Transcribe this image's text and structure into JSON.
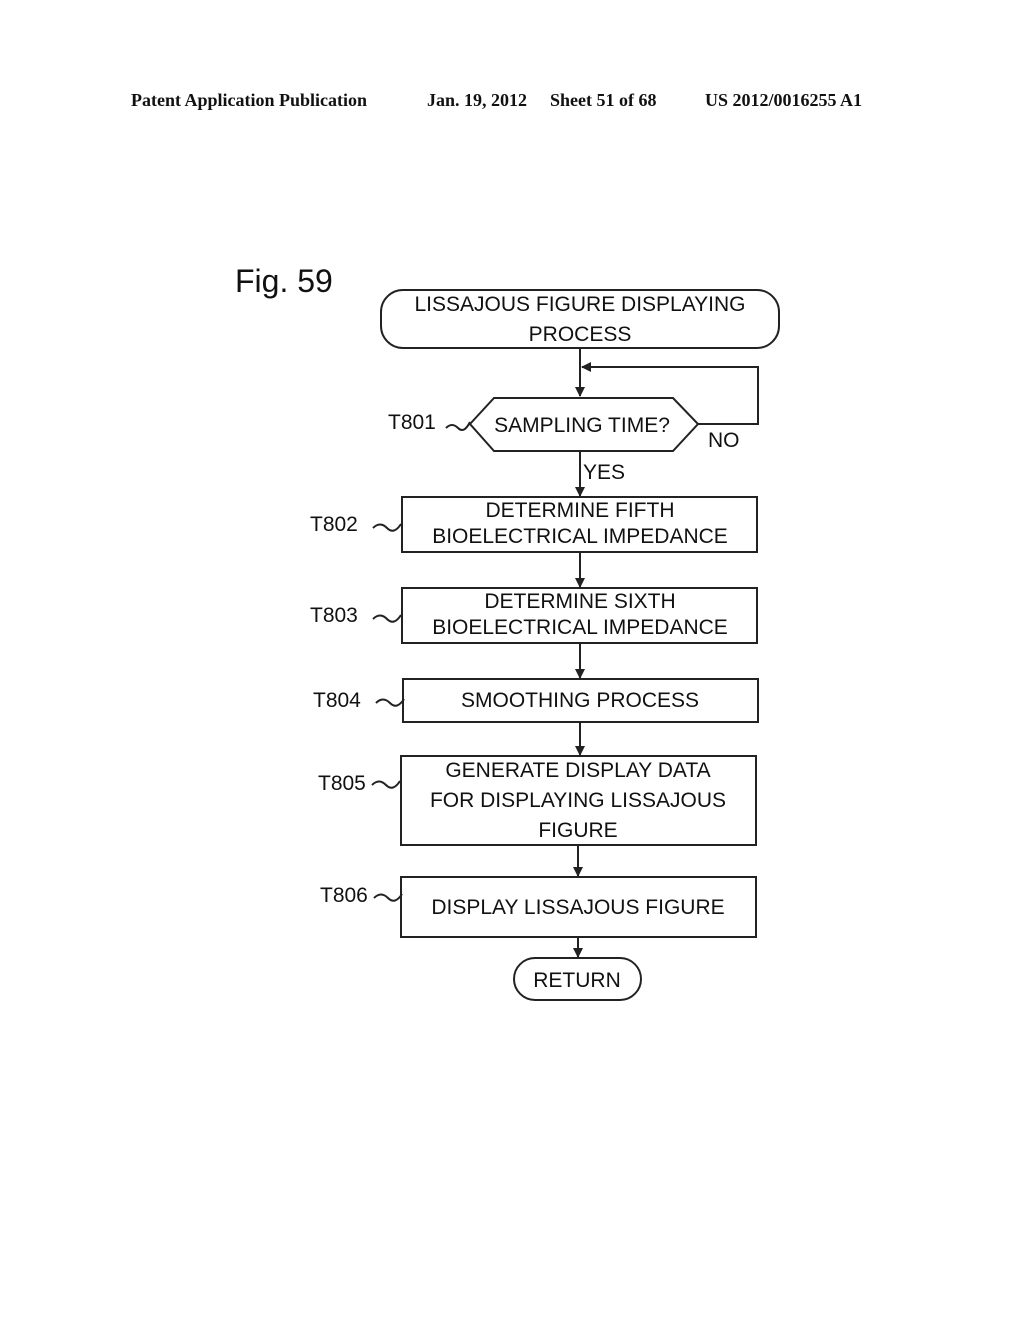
{
  "header": {
    "publication": "Patent Application Publication",
    "date": "Jan. 19, 2012",
    "sheet": "Sheet 51 of 68",
    "patent_number": "US 2012/0016255 A1"
  },
  "figure": {
    "label": "Fig. 59",
    "start": {
      "line1": "LISSAJOUS FIGURE DISPLAYING",
      "line2": "PROCESS"
    },
    "decision": {
      "ref": "T801",
      "text": "SAMPLING TIME?",
      "no_label": "NO",
      "yes_label": "YES"
    },
    "steps": [
      {
        "ref": "T802",
        "lines": [
          "DETERMINE FIFTH",
          "BIOELECTRICAL IMPEDANCE"
        ]
      },
      {
        "ref": "T803",
        "lines": [
          "DETERMINE SIXTH",
          "BIOELECTRICAL IMPEDANCE"
        ]
      },
      {
        "ref": "T804",
        "lines": [
          "SMOOTHING PROCESS"
        ]
      },
      {
        "ref": "T805",
        "lines": [
          "GENERATE DISPLAY DATA",
          "FOR DISPLAYING LISSAJOUS",
          "FIGURE"
        ]
      },
      {
        "ref": "T806",
        "lines": [
          "DISPLAY LISSAJOUS FIGURE"
        ]
      }
    ],
    "end": {
      "text": "RETURN"
    }
  }
}
